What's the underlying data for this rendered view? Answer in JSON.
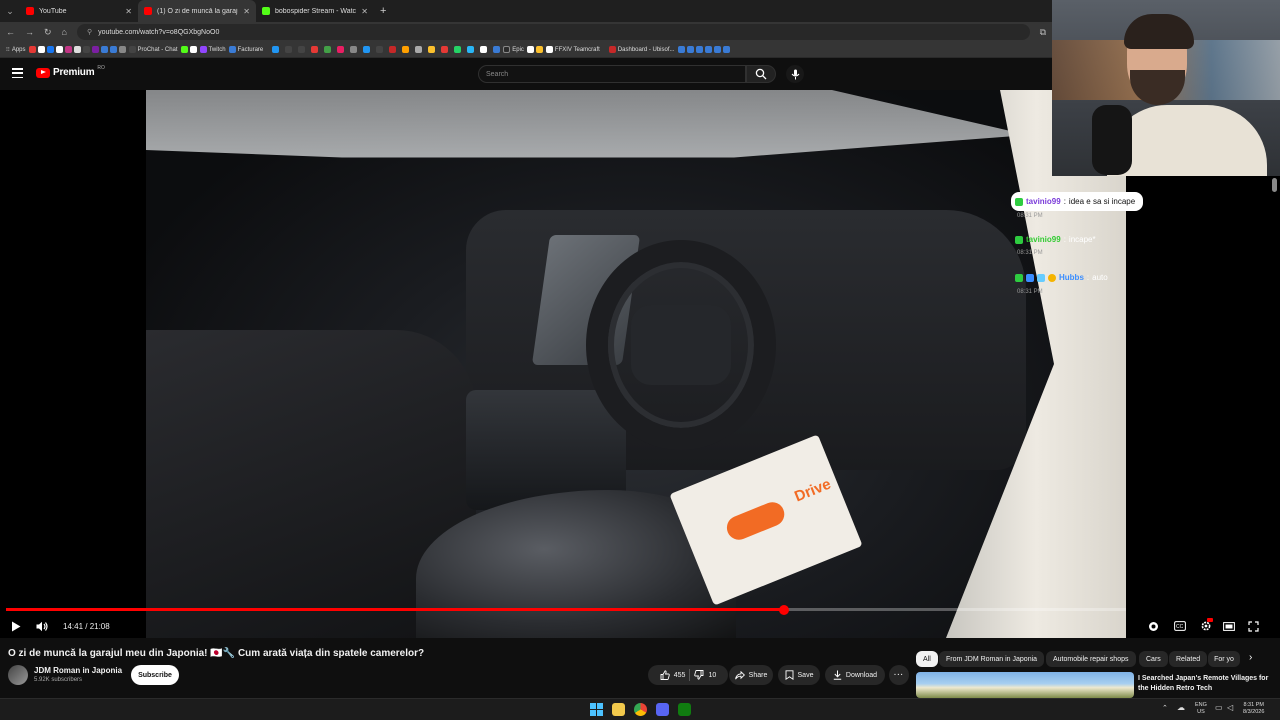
{
  "browser": {
    "tabs": [
      {
        "title": "YouTube",
        "active": false,
        "color": "#ff0000"
      },
      {
        "title": "(1) O zi de muncă la garajul me",
        "active": true,
        "color": "#ff0000"
      },
      {
        "title": "bobospider Stream - Watch Li",
        "active": false,
        "color": "#53fc18"
      }
    ],
    "url": "youtube.com/watch?v=o8QGXbgNoO0",
    "bookmarks": [
      {
        "label": "Apps",
        "color": "#888888"
      },
      {
        "label": "ProChat - Chat",
        "color": "#444444"
      },
      {
        "label": "Twitch",
        "color": "#9146ff"
      },
      {
        "label": "Facturare",
        "color": "#3a7bd5"
      },
      {
        "label": "Epic",
        "color": "#2b2b2b"
      },
      {
        "label": "FFXIV Teamcraft",
        "color": "#ffffff"
      },
      {
        "label": "Dashboard - Ubisof...",
        "color": "#c62828"
      }
    ]
  },
  "youtube": {
    "logo_text": "Premium",
    "logo_badge": "RO",
    "search_placeholder": "Search"
  },
  "player": {
    "current_time": "14:41",
    "duration": "21:08",
    "time_display": "14:41 / 21:08",
    "progress_fraction": 0.695,
    "floor_mat_text": "Drive"
  },
  "chat": [
    {
      "user": "tavinio99",
      "message": "idea e sa si incape",
      "highlighted": true,
      "time": "08:31 PM",
      "name_color": "#7a3bd9"
    },
    {
      "user": "tavinio99",
      "message": "incape*",
      "highlighted": false,
      "time": "08:31 PM",
      "name_color": "#33cc33"
    },
    {
      "user": "Hubbs",
      "message": "auto",
      "highlighted": false,
      "time": "08:31 PM",
      "name_color": "#3a8dff"
    }
  ],
  "video": {
    "title": "O zi de muncă la garajul meu din Japonia! 🇯🇵🔧 Cum arată viața din spatele camerelor?",
    "channel": "JDM Roman in Japonia",
    "subscribers": "5.92K subscribers",
    "subscribe_label": "Subscribe",
    "likes": "455",
    "dislikes": "10",
    "share_label": "Share",
    "save_label": "Save",
    "download_label": "Download"
  },
  "chips": [
    "All",
    "From JDM Roman in Japonia",
    "Automobile repair shops",
    "Cars",
    "Related",
    "For yo"
  ],
  "recommendation": {
    "title": "I Searched Japan's Remote Villages for the Hidden Retro Tech"
  },
  "taskbar": {
    "lang": "ENG",
    "region": "US",
    "time": "8:31 PM",
    "date": "8/3/2026"
  }
}
